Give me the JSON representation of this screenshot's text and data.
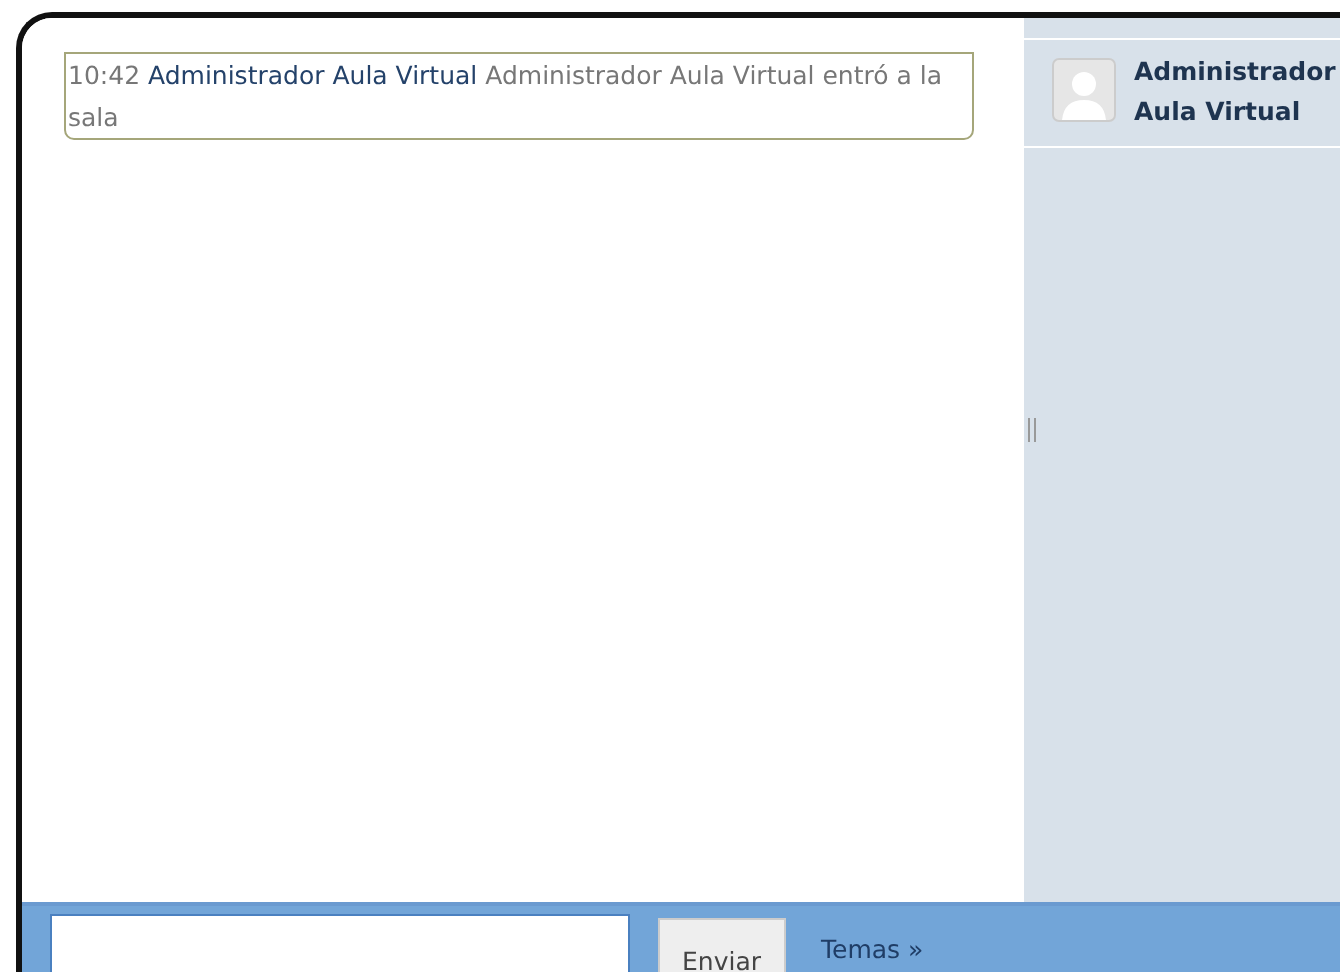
{
  "messages": [
    {
      "time": "10:42",
      "user": "Administrador Aula Virtual",
      "text": "Administrador Aula Virtual entró a la sala"
    }
  ],
  "users": [
    {
      "name": "Administrador Aula Virtual"
    }
  ],
  "composer": {
    "send_label": "Enviar",
    "topics_link": "Temas »"
  }
}
